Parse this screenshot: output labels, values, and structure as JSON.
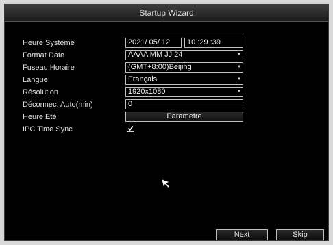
{
  "window": {
    "title": "Startup Wizard"
  },
  "form": {
    "system_time": {
      "label": "Heure Système",
      "date": "2021/ 05/ 12",
      "time": "10 :29 :39"
    },
    "date_format": {
      "label": "Format Date",
      "value": "AAAA MM JJ 24"
    },
    "timezone": {
      "label": "Fuseau Horaire",
      "value": "(GMT+8:00)Beijing"
    },
    "language": {
      "label": "Langue",
      "value": "Français"
    },
    "resolution": {
      "label": "Résolution",
      "value": "1920x1080"
    },
    "auto_logout": {
      "label": "Déconnec. Auto(min)",
      "value": "0"
    },
    "dst": {
      "label": "Heure Eté",
      "button": "Parametre"
    },
    "ipc_time_sync": {
      "label": "IPC Time Sync",
      "checked": true
    }
  },
  "footer": {
    "next_label": "Next",
    "skip_label": "Skip"
  },
  "icons": {
    "dropdown": "chevron-down-icon",
    "checkbox": "checkmark-icon",
    "cursor": "mouse-pointer-icon"
  },
  "colors": {
    "background": "#000000",
    "text": "#e6e6e6",
    "border": "#bfbfbf"
  }
}
